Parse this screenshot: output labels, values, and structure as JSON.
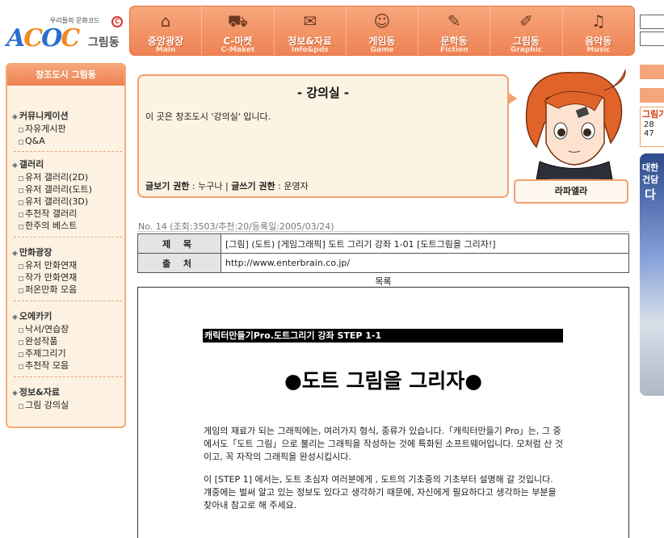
{
  "logo": {
    "small_text": "우리들의 문화코드",
    "copyright_mark": "C",
    "brand": "ACOC",
    "dong": "그림동"
  },
  "nav": [
    {
      "label": "중앙광장",
      "sub": "Main",
      "icon": "building-icon"
    },
    {
      "label": "C-마켓",
      "sub": "C-Maket",
      "icon": "cart-icon"
    },
    {
      "label": "정보&자료",
      "sub": "Info&pds",
      "icon": "folder-icon"
    },
    {
      "label": "게임동",
      "sub": "Game",
      "icon": "game-icon"
    },
    {
      "label": "문학동",
      "sub": "Fiction",
      "icon": "book-icon"
    },
    {
      "label": "그림동",
      "sub": "Graphic",
      "icon": "palette-icon"
    },
    {
      "label": "음악동",
      "sub": "Music",
      "icon": "headphones-icon"
    }
  ],
  "sidebar": {
    "title": "창조도시 그림동",
    "sections": [
      {
        "head": "커뮤니케이션",
        "items": [
          "자유게시판",
          "Q&A"
        ]
      },
      {
        "head": "갤러리",
        "items": [
          "유저 갤러리(2D)",
          "유저 갤러리(도트)",
          "유저 갤러리(3D)",
          "추천작 갤러리",
          "한주의 베스트"
        ]
      },
      {
        "head": "만화광장",
        "items": [
          "유저 만화연재",
          "작가 만화연재",
          "퍼온만화 모음"
        ]
      },
      {
        "head": "오에카키",
        "items": [
          "낙서/연습장",
          "완성작품",
          "주제그리기",
          "추천작 모음"
        ]
      },
      {
        "head": "정보&자료",
        "items": [
          "그림 강의실"
        ]
      }
    ]
  },
  "room": {
    "title": "- 강의실 -",
    "desc": "이 곳은 창조도시 '강의실' 입니다.",
    "read_label": "글보기 권한",
    "read_value": " : 누구나 | ",
    "write_label": "글쓰기 권한",
    "write_value": " : 운영자"
  },
  "character": {
    "name": "라파엘라"
  },
  "right_edge": {
    "title": "그림가",
    "items": [
      "28",
      "47"
    ],
    "ad_line1": "대한",
    "ad_line2": "건담",
    "ad_line3": "다"
  },
  "post": {
    "meta": "No. 14 (조회:3503/추천:20/등록일:2005/03/24)",
    "subject_label": "제 목",
    "subject": "[그림] (도트) [게임그래픽] 도트 그리기 강좌 1-01 [도트그림을 그리자!]",
    "source_label": "출 처",
    "source": "http://www.enterbrain.co.jp/",
    "list_link": "목록"
  },
  "article": {
    "bar": "캐릭터만들기Pro.도트그리기 강좌 STEP 1-1",
    "heading": "●도트 그림을 그리자●",
    "p1_l1": "게임의 재료가 되는 그래픽에는, 여러가지 형식, 종류가 있습니다.「캐릭터만들기 Pro」는, 그 중",
    "p1_l2": "에서도「도트 그림」으로 불리는 그래픽을 작성하는 것에 특화된 소프트웨어입니다. 모처럼 산 것",
    "p1_l3": "이고, 꼭 자작의 그래픽을 완성시킵시다.",
    "p2_l1": "이 [STEP 1] 에서는, 도트 초심자 여러분에게 , 도트의 기초중의 기초부터 설명해 갈 것입니다.",
    "p2_l2": "걔중에는 벌써 알고 있는 정보도 있다고 생각하기 때문에, 자신에게 필요하다고 생각하는 부분을",
    "p2_l3": "찾아내 참고로 해 주세요."
  }
}
